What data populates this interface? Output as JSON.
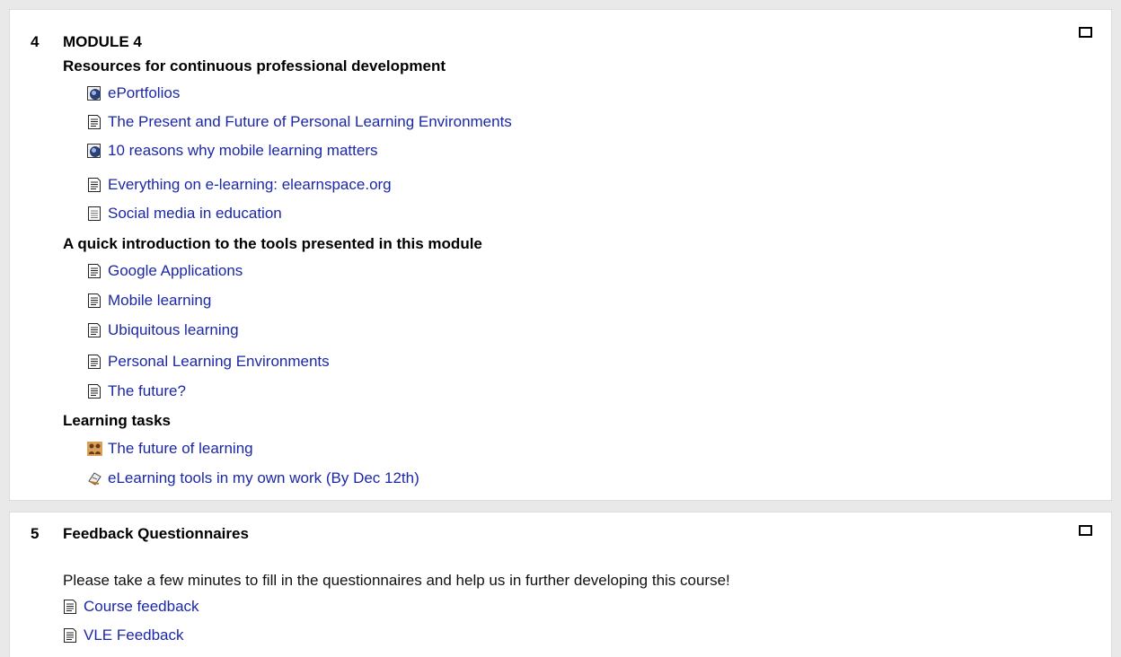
{
  "sections": [
    {
      "number": "4",
      "title": "MODULE 4",
      "groups": [
        {
          "heading": "Resources for continuous professional development",
          "items": [
            {
              "label": "ePortfolios",
              "icon": "globe-icon"
            },
            {
              "label": "The Present and Future of Personal Learning Environments",
              "icon": "document-icon"
            },
            {
              "label": "10 reasons why mobile learning matters",
              "icon": "globe-icon"
            },
            {
              "label": "Everything on e-learning: elearnspace.org",
              "icon": "document-icon"
            },
            {
              "label": "Social media in education",
              "icon": "text-file-icon"
            }
          ]
        },
        {
          "heading": "A quick introduction to the tools presented in this module",
          "items": [
            {
              "label": "Google Applications",
              "icon": "document-icon"
            },
            {
              "label": "Mobile learning",
              "icon": "document-icon"
            },
            {
              "label": "Ubiquitous learning",
              "icon": "document-icon"
            },
            {
              "label": "Personal Learning Environments",
              "icon": "document-icon"
            },
            {
              "label": "The future?",
              "icon": "document-icon"
            }
          ]
        },
        {
          "heading": "Learning tasks",
          "items": [
            {
              "label": "The future of learning",
              "icon": "forum-icon"
            },
            {
              "label": "eLearning tools in my own work (By Dec 12th)",
              "icon": "assignment-icon"
            }
          ]
        }
      ]
    },
    {
      "number": "5",
      "title": "Feedback Questionnaires",
      "summary": "Please take a few minutes to fill in the questionnaires and help us in further developing this course!",
      "items": [
        {
          "label": "Course feedback",
          "icon": "document-icon"
        },
        {
          "label": "VLE Feedback",
          "icon": "document-icon"
        }
      ]
    }
  ],
  "colors": {
    "link": "#1c27a8",
    "background": "#e9e9e9",
    "panel": "#ffffff"
  }
}
